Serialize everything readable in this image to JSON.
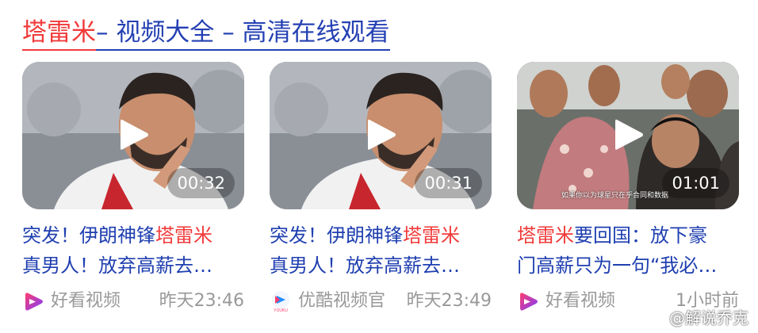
{
  "title": {
    "highlight": "塔雷米",
    "rest": " – 视频大全 – 高清在线观看"
  },
  "videos": [
    {
      "duration": "00:32",
      "line1_pre": "突发！伊朗神锋",
      "line1_red": "塔雷米",
      "line2": "真男人！放弃高薪去…",
      "source": "好看视频",
      "source_icon": "haokan-logo-icon",
      "time": "昨天23:46"
    },
    {
      "duration": "00:31",
      "line1_pre": "突发！伊朗神锋",
      "line1_red": "塔雷米",
      "line2": "真男人！放弃高薪去…",
      "source": "优酷视频官",
      "source_icon": "youku-logo-icon",
      "time": "昨天23:49"
    },
    {
      "duration": "01:01",
      "line1_red": "塔雷米",
      "line1_post": "要回国：放下豪",
      "line2": "门高薪只为一句“我必…",
      "source": "好看视频",
      "source_icon": "haokan-logo-icon",
      "time": "1小时前",
      "subtitle": "如果你以为球星只在乎合同和数据"
    }
  ],
  "watermark": "@解说乔克",
  "colors": {
    "title_blue": "#2440b3",
    "highlight_red": "#f23a3a",
    "meta_gray": "#999999"
  }
}
